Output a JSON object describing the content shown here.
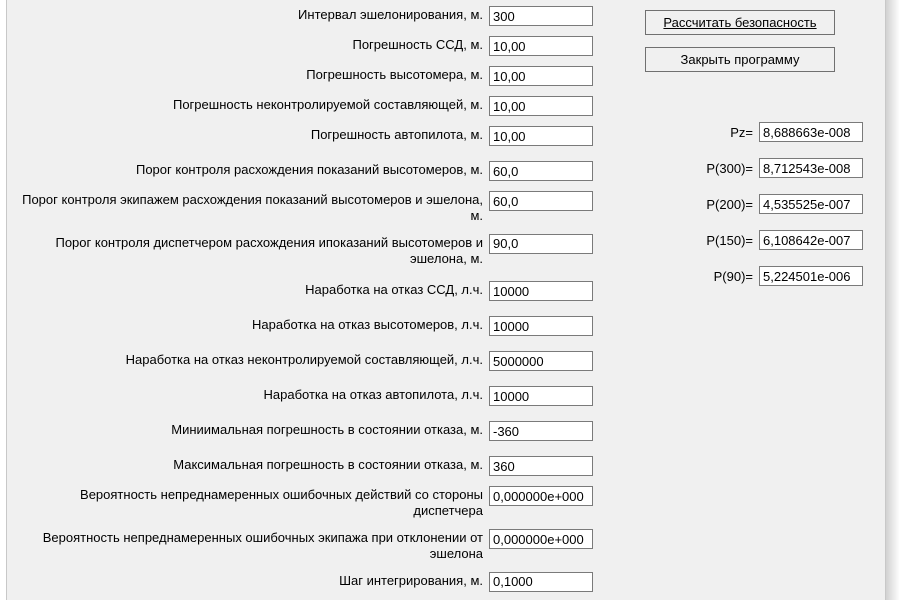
{
  "fields": [
    {
      "label": "Интервал эшелонирования, м.",
      "value": "300"
    },
    {
      "label": "Погрешность ССД, м.",
      "value": "10,00"
    },
    {
      "label": "Погрешность высотомера, м.",
      "value": "10,00"
    },
    {
      "label": "Погрешность неконтролируемой составляющей, м.",
      "value": "10,00"
    },
    {
      "label": "Погрешность автопилота, м.",
      "value": "10,00"
    },
    {
      "label": "Порог контроля расхождения показаний высотомеров, м.",
      "value": "60,0"
    },
    {
      "label": "Порог контроля экипажем расхождения показаний высотомеров и эшелона, м.",
      "value": "60,0"
    },
    {
      "label": "Порог контроля диспетчером расхождения ипоказаний высотомеров и эшелона, м.",
      "value": "90,0"
    },
    {
      "label": "Наработка на отказ ССД, л.ч.",
      "value": "10000"
    },
    {
      "label": "Наработка на отказ высотомеров, л.ч.",
      "value": "10000"
    },
    {
      "label": "Наработка на отказ неконтролируемой составляющей, л.ч.",
      "value": "5000000"
    },
    {
      "label": "Наработка на отказ автопилота, л.ч.",
      "value": "10000"
    },
    {
      "label": "Миниимальная погрешность в состоянии отказа, м.",
      "value": "-360"
    },
    {
      "label": "Максимальная погрешность в состоянии отказа, м.",
      "value": "360"
    },
    {
      "label": "Вероятность непреднамеренных ошибочных действий со стороны диспетчера",
      "value": "0,000000e+000"
    },
    {
      "label": "Вероятность непреднамеренных ошибочных экипажа при отклонении от эшелона",
      "value": "0,000000e+000"
    },
    {
      "label": "Шаг интегрирования, м.",
      "value": "0,1000"
    }
  ],
  "buttons": {
    "calc": "Рассчитать безопасность",
    "close": "Закрыть программу"
  },
  "results": [
    {
      "label": "Pz=",
      "value": "8,688663e-008"
    },
    {
      "label": "P(300)=",
      "value": "8,712543e-008"
    },
    {
      "label": "P(200)=",
      "value": "4,535525e-007"
    },
    {
      "label": "P(150)=",
      "value": "6,108642e-007"
    },
    {
      "label": "P(90)=",
      "value": "5,224501e-006"
    }
  ],
  "multilineIdx": [
    6,
    7,
    14,
    15
  ],
  "extraGapAfter": [
    4,
    7,
    8,
    9,
    10,
    11,
    12
  ]
}
